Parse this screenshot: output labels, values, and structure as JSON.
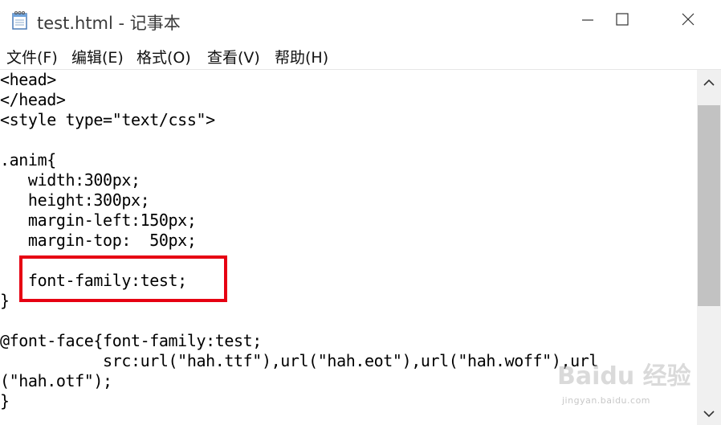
{
  "window": {
    "title": "test.html - 记事本"
  },
  "icons": {
    "app": "notepad-icon",
    "minimize": "minimize-icon",
    "maximize": "maximize-icon",
    "close": "close-icon",
    "scroll_up": "chevron-up-icon",
    "scroll_down": "chevron-down-icon",
    "watermark": "baidu-jingyan-logo"
  },
  "menu": {
    "items": [
      {
        "label": "文件(F)"
      },
      {
        "label": "编辑(E)"
      },
      {
        "label": "格式(O)"
      },
      {
        "label": "查看(V)"
      },
      {
        "label": "帮助(H)"
      }
    ]
  },
  "editor": {
    "lines": [
      "<head>",
      "</head>",
      "<style type=\"text/css\">",
      "",
      ".anim{",
      "   width:300px;",
      "   height:300px;",
      "   margin-left:150px;",
      "   margin-top:  50px;",
      "",
      "   font-family:test;",
      "}",
      "",
      "@font-face{font-family:test;",
      "           src:url(\"hah.ttf\"),url(\"hah.eot\"),url(\"hah.woff\"),url",
      "(\"hah.otf\");",
      "}"
    ]
  },
  "watermark": {
    "text": "Baidu 经验",
    "url_text": "jingyan.baidu.com"
  },
  "colors": {
    "highlight": "#e60012",
    "scroll_thumb": "#c2c2c2",
    "scroll_track": "#f0f0f0"
  }
}
